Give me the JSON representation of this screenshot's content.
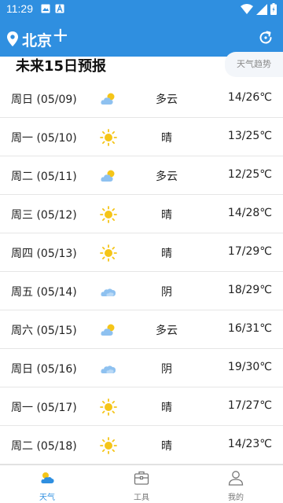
{
  "status_bar": {
    "time": "11:29"
  },
  "header": {
    "city": "北京",
    "add_label": "+"
  },
  "section": {
    "title": "未来15日预报",
    "trend_label": "天气趋势"
  },
  "forecast": [
    {
      "day": "周日 (05/09)",
      "icon": "cloudy-icon",
      "condition": "多云",
      "temp": "14/26℃"
    },
    {
      "day": "周一 (05/10)",
      "icon": "sunny-icon",
      "condition": "晴",
      "temp": "13/25℃"
    },
    {
      "day": "周二 (05/11)",
      "icon": "cloudy-icon",
      "condition": "多云",
      "temp": "12/25℃"
    },
    {
      "day": "周三 (05/12)",
      "icon": "sunny-icon",
      "condition": "晴",
      "temp": "14/28℃"
    },
    {
      "day": "周四 (05/13)",
      "icon": "sunny-icon",
      "condition": "晴",
      "temp": "17/29℃"
    },
    {
      "day": "周五 (05/14)",
      "icon": "overcast-icon",
      "condition": "阴",
      "temp": "18/29℃"
    },
    {
      "day": "周六 (05/15)",
      "icon": "cloudy-icon",
      "condition": "多云",
      "temp": "16/31℃"
    },
    {
      "day": "周日 (05/16)",
      "icon": "overcast-icon",
      "condition": "阴",
      "temp": "19/30℃"
    },
    {
      "day": "周一 (05/17)",
      "icon": "sunny-icon",
      "condition": "晴",
      "temp": "17/27℃"
    },
    {
      "day": "周二 (05/18)",
      "icon": "sunny-icon",
      "condition": "晴",
      "temp": "14/23℃"
    }
  ],
  "nav": {
    "weather": "天气",
    "tools": "工具",
    "mine": "我的"
  },
  "colors": {
    "primary": "#2f8fe0",
    "sun": "#f5c518",
    "cloud": "#8ec1f0"
  }
}
